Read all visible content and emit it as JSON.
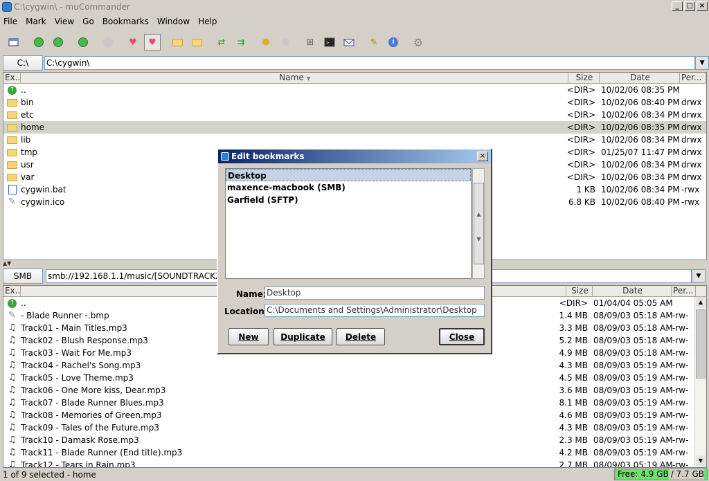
{
  "window": {
    "title": "C:\\cygwin\\ - muCommander"
  },
  "menu": [
    "File",
    "Mark",
    "View",
    "Go",
    "Bookmarks",
    "Window",
    "Help"
  ],
  "top": {
    "drive": "C:\\",
    "path": "C:\\cygwin\\",
    "columns": {
      "ext": "Ex...",
      "name": "Name",
      "size": "Size",
      "date": "Date",
      "perm": "Per..."
    },
    "rows": [
      {
        "icon": "parent-folder-icon",
        "name": "..",
        "size": "<DIR>",
        "date": "10/02/06 08:35 PM",
        "perm": ""
      },
      {
        "icon": "folder-icon",
        "name": "bin",
        "size": "<DIR>",
        "date": "10/02/06 08:40 PM",
        "perm": "drwx"
      },
      {
        "icon": "folder-icon",
        "name": "etc",
        "size": "<DIR>",
        "date": "10/02/06 08:34 PM",
        "perm": "drwx"
      },
      {
        "icon": "folder-icon",
        "name": "home",
        "size": "<DIR>",
        "date": "10/02/06 08:35 PM",
        "perm": "drwx"
      },
      {
        "icon": "folder-icon",
        "name": "lib",
        "size": "<DIR>",
        "date": "10/02/06 08:34 PM",
        "perm": "drwx"
      },
      {
        "icon": "folder-icon",
        "name": "tmp",
        "size": "<DIR>",
        "date": "01/25/07 11:47 PM",
        "perm": "drwx"
      },
      {
        "icon": "folder-icon",
        "name": "usr",
        "size": "<DIR>",
        "date": "10/02/06 08:34 PM",
        "perm": "drwx"
      },
      {
        "icon": "folder-icon",
        "name": "var",
        "size": "<DIR>",
        "date": "10/02/06 08:34 PM",
        "perm": "drwx"
      },
      {
        "icon": "batch-file-icon",
        "name": "cygwin.bat",
        "size": "1 KB",
        "date": "10/02/06 08:34 PM",
        "perm": "-rwx"
      },
      {
        "icon": "file-icon",
        "name": "cygwin.ico",
        "size": "6.8 KB",
        "date": "10/02/06 08:40 PM",
        "perm": "-rwx"
      }
    ]
  },
  "bottom": {
    "drive": "SMB",
    "path": "smb://192.168.1.1/music/[SOUNDTRACKZ]/",
    "columns": {
      "ext": "Ex...",
      "size": "Size",
      "date": "Date",
      "perm": "Per..."
    },
    "rows": [
      {
        "icon": "parent-folder-icon",
        "name": "..",
        "size": "<DIR>",
        "date": "01/04/04 05:05 AM",
        "perm": ""
      },
      {
        "icon": "file-icon",
        "name": "- Blade Runner -.bmp",
        "size": "1.4 MB",
        "date": "08/09/03 05:18 AM",
        "perm": "-rw-"
      },
      {
        "icon": "music-icon",
        "name": "Track01 - Main Titles.mp3",
        "size": "3.3 MB",
        "date": "08/09/03 05:18 AM",
        "perm": "-rw-"
      },
      {
        "icon": "music-icon",
        "name": "Track02 - Blush Response.mp3",
        "size": "5.2 MB",
        "date": "08/09/03 05:18 AM",
        "perm": "-rw-"
      },
      {
        "icon": "music-icon",
        "name": "Track03 - Wait For Me.mp3",
        "size": "4.9 MB",
        "date": "08/09/03 05:18 AM",
        "perm": "-rw-"
      },
      {
        "icon": "music-icon",
        "name": "Track04 - Rachel's Song.mp3",
        "size": "4.3 MB",
        "date": "08/09/03 05:19 AM",
        "perm": "-rw-"
      },
      {
        "icon": "music-icon",
        "name": "Track05 - Love Theme.mp3",
        "size": "4.5 MB",
        "date": "08/09/03 05:19 AM",
        "perm": "-rw-"
      },
      {
        "icon": "music-icon",
        "name": "Track06 - One More kiss, Dear.mp3",
        "size": "3.6 MB",
        "date": "08/09/03 05:19 AM",
        "perm": "-rw-"
      },
      {
        "icon": "music-icon",
        "name": "Track07 - Blade Runner Blues.mp3",
        "size": "8.1 MB",
        "date": "08/09/03 05:19 AM",
        "perm": "-rw-"
      },
      {
        "icon": "music-icon",
        "name": "Track08 - Memories of Green.mp3",
        "size": "4.6 MB",
        "date": "08/09/03 05:19 AM",
        "perm": "-rw-"
      },
      {
        "icon": "music-icon",
        "name": "Track09 - Tales of the Future.mp3",
        "size": "4.3 MB",
        "date": "08/09/03 05:19 AM",
        "perm": "-rw-"
      },
      {
        "icon": "music-icon",
        "name": "Track10 - Damask Rose.mp3",
        "size": "2.3 MB",
        "date": "08/09/03 05:19 AM",
        "perm": "-rw-"
      },
      {
        "icon": "music-icon",
        "name": "Track11 - Blade Runner (End title).mp3",
        "size": "4.2 MB",
        "date": "08/09/03 05:19 AM",
        "perm": "-rw-"
      },
      {
        "icon": "music-icon",
        "name": "Track12 - Tears in Rain.mp3",
        "size": "2.7 MB",
        "date": "08/09/03 05:19 AM",
        "perm": "-rw-"
      }
    ]
  },
  "status": {
    "text": "1 of 9 selected - home",
    "free": "Free: 4.9 GB",
    "total": "/ 7.7 GB"
  },
  "dialog": {
    "title": "Edit bookmarks",
    "bookmarks": [
      "Desktop",
      "maxence-macbook (SMB)",
      "Garfield (SFTP)"
    ],
    "name_label": "Name:",
    "name_value": "Desktop",
    "location_label": "Location:",
    "location_value": "C:\\Documents and Settings\\Administrator\\Desktop",
    "buttons": {
      "new": "New",
      "duplicate": "Duplicate",
      "delete": "Delete",
      "close": "Close"
    }
  }
}
